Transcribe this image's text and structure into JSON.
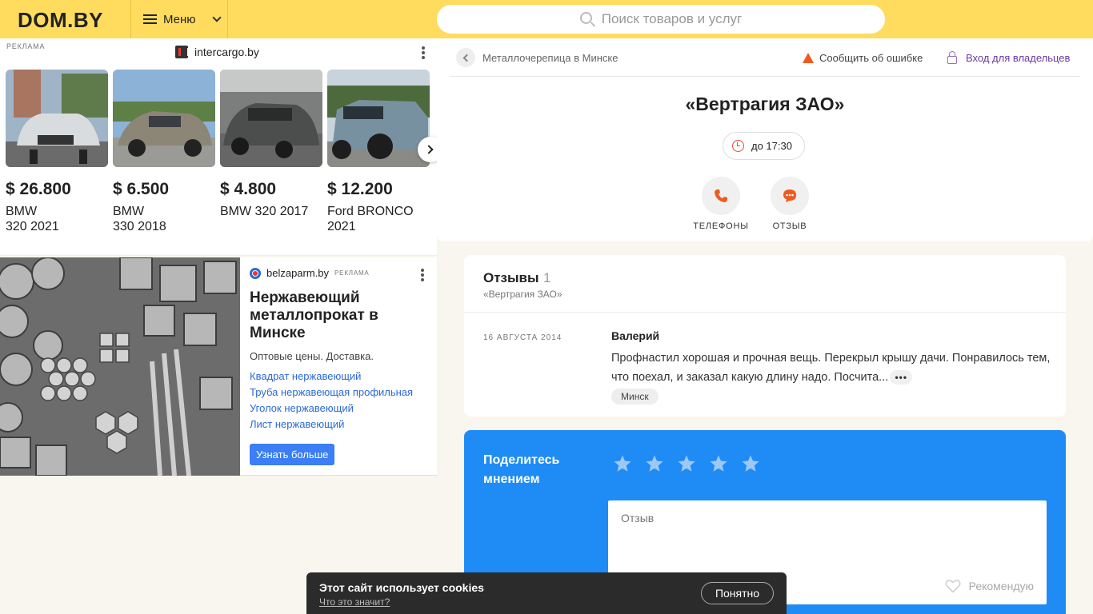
{
  "header": {
    "logo": "DOM.BY",
    "menu_label": "Меню",
    "search_placeholder": "Поиск товаров и услуг"
  },
  "ad_cars": {
    "tag": "РЕКЛАМА",
    "domain": "intercargo.by",
    "items": [
      {
        "price": "$ 26.800",
        "name": "BMW\n320 2021"
      },
      {
        "price": "$ 6.500",
        "name": "BMW\n330 2018"
      },
      {
        "price": "$ 4.800",
        "name": "BMW 320 2017"
      },
      {
        "price": "$ 12.200",
        "name": "Ford BRONCO\n2021"
      }
    ]
  },
  "ad_metal": {
    "domain": "belzaparm.by",
    "tag": "РЕКЛАМА",
    "title": "Нержавеющий металлопрокат в Минске",
    "subtitle": "Оптовые цены. Доставка.",
    "links": [
      "Квадрат нержавеющий",
      "Труба нержавеющая профильная",
      "Уголок нержавеющий",
      "Лист нержавеющий"
    ],
    "button": "Узнать больше"
  },
  "company": {
    "breadcrumb": "Металлочерепица в Минске",
    "report": "Сообщить об ошибке",
    "owner_login": "Вход для владельцев",
    "name": "«Вертрагия ЗАО»",
    "hours": "до 17:30",
    "actions": {
      "phones": "ТЕЛЕФОНЫ",
      "review": "ОТЗЫВ"
    },
    "colors": {
      "accent": "#ef5a1f",
      "owner_link": "#6a3aa3"
    }
  },
  "reviews": {
    "title": "Отзывы",
    "count": "1",
    "subtitle": "«Вертрагия ЗАО»",
    "items": [
      {
        "date": "16 АВГУСТА 2014",
        "author": "Валерий",
        "text": "Профнастил хорошая и прочная вещь. Перекрыл крышу дачи. Понравилось тем, что поехал, и заказал какую длину надо. Посчита...",
        "more": "•••",
        "city": "Минск"
      }
    ]
  },
  "share": {
    "title": "Поделитесь мнением",
    "stars": 5,
    "placeholder": "Отзыв",
    "recommend": "Рекомендую",
    "color": "#1f8cf6"
  },
  "cookies": {
    "title": "Этот сайт использует cookies",
    "link": "Что это значит?",
    "button": "Понятно"
  }
}
